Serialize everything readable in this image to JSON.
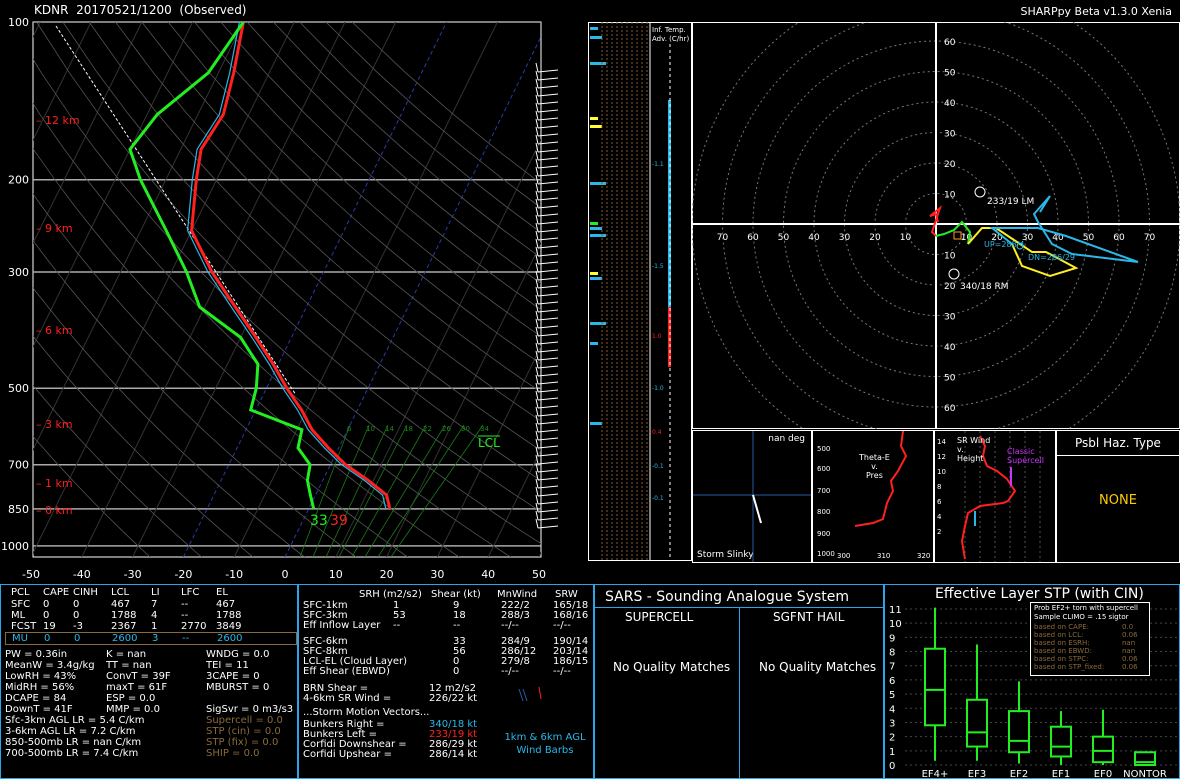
{
  "header": {
    "station": "KDNR",
    "datetime": "20170521/1200",
    "type": "(Observed)",
    "version": "SHARPpy Beta v1.3.0 Xenia"
  },
  "skewt": {
    "pressure_ticks": [
      "100",
      "200",
      "300",
      "500",
      "700",
      "850",
      "1000"
    ],
    "temp_ticks": [
      "-50",
      "-40",
      "-30",
      "-20",
      "-10",
      "0",
      "10",
      "20",
      "30",
      "40",
      "50"
    ],
    "height_labels": [
      "12 km",
      "9 km",
      "6 km",
      "3 km",
      "1 km",
      "0 km"
    ],
    "lcl_label": "LCL",
    "mixing_ratio_labels": [
      "6",
      "10",
      "14",
      "18",
      "22",
      "26",
      "30",
      "34"
    ],
    "surface_dewpoint": "33",
    "surface_temp": "39",
    "colors": {
      "temperature": "#ff2020",
      "dewpoint": "#22ee22",
      "virtual": "#2ab8e8",
      "dry_adiabat": "#555555"
    }
  },
  "chart_data": {
    "type": "line",
    "title": "",
    "xlabel": "",
    "ylabel": "",
    "pressure_levels_hPa": [
      850,
      800,
      750,
      700,
      650,
      600,
      550,
      500,
      450,
      400,
      350,
      300,
      250,
      200,
      175,
      150,
      125,
      100
    ],
    "series": [
      {
        "values": [
          16,
          14,
          9,
          3,
          -2,
          -7,
          -11,
          -16,
          -21,
          -27,
          -34,
          -42,
          -50,
          -54,
          -56,
          -55,
          -57,
          -60
        ]
      },
      {
        "values": [
          1,
          -1,
          -3,
          -4,
          -8,
          -9,
          -21,
          -22,
          -24,
          -30,
          -41,
          -47,
          -55,
          -65,
          -70,
          -68,
          -62,
          -60
        ]
      }
    ],
    "xlim": [
      -50,
      50
    ],
    "ylim": [
      1000,
      100
    ]
  },
  "inferred_temp_adv": {
    "title": "Inf. Temp. Adv. (C/hr)",
    "values": [
      "-1.1",
      "-1.5",
      "1.0",
      "-1.0",
      "0.4",
      "-0.1",
      "-0.1"
    ]
  },
  "hodograph": {
    "rings": [
      "10",
      "20",
      "30",
      "40",
      "50",
      "60"
    ],
    "axis_labels": [
      "70",
      "60",
      "50",
      "40",
      "30",
      "20",
      "10",
      "10",
      "20",
      "30",
      "40",
      "50",
      "60",
      "70"
    ],
    "lm_label": "233/19 LM",
    "rm_label": "340/18 RM",
    "up_label": "UP=288/4",
    "dn_label": "DN=286/29"
  },
  "storm_slinky": {
    "title": "nan deg",
    "footer": "Storm Slinky"
  },
  "theta_e": {
    "title": "Theta-E v. Pres",
    "ticks_y": [
      "500",
      "600",
      "700",
      "800",
      "900",
      "1000"
    ],
    "ticks_x": [
      "300",
      "310",
      "320"
    ]
  },
  "srwind": {
    "title": "SR Wind v. Height",
    "ticks": [
      "14",
      "12",
      "10",
      "8",
      "6",
      "4",
      "2"
    ],
    "supercell_label": "Classic Supercell"
  },
  "psbl_haz": {
    "title": "Psbl Haz. Type",
    "value": "NONE"
  },
  "parcel_table": {
    "headers": [
      "PCL",
      "CAPE",
      "CINH",
      "LCL",
      "LI",
      "LFC",
      "EL"
    ],
    "rows": [
      [
        "SFC",
        "0",
        "0",
        "467",
        "7",
        "--",
        "467"
      ],
      [
        "ML",
        "0",
        "0",
        "1788",
        "4",
        "--",
        "1788"
      ],
      [
        "FCST",
        "19",
        "-3",
        "2367",
        "1",
        "2770",
        "3849"
      ],
      [
        "MU",
        "0",
        "0",
        "2600",
        "3",
        "--",
        "2600"
      ]
    ]
  },
  "indices": {
    "left": [
      "PW = 0.36in",
      "MeanW = 3.4g/kg",
      "LowRH = 43%",
      "MidRH = 56%",
      "DCAPE = 84",
      "DownT = 41F"
    ],
    "mid": [
      "K = nan",
      "TT = nan",
      "ConvT = 39F",
      "maxT = 61F",
      "ESP = 0.0",
      "MMP = 0.0"
    ],
    "right": [
      "WNDG = 0.0",
      "TEI = 11",
      "3CAPE = 0",
      "MBURST = 0",
      "",
      "SigSvr = 0 m3/s3"
    ],
    "lapse": [
      "Sfc-3km AGL LR = 5.4 C/km",
      "3-6km AGL LR = 7.2 C/km",
      "850-500mb LR = nan C/km",
      "700-500mb LR = 7.4 C/km"
    ],
    "composites": [
      "Supercell = 0.0",
      "STP (cin) = 0.0",
      "STP (fix) = 0.0",
      "SHIP = 0.0"
    ]
  },
  "kinematics": {
    "headers": [
      "SRH (m2/s2)",
      "Shear (kt)",
      "MnWind",
      "SRW"
    ],
    "rows": [
      [
        "SFC-1km",
        "1",
        "9",
        "222/2",
        "165/18"
      ],
      [
        "SFC-3km",
        "53",
        "18",
        "288/3",
        "168/16"
      ],
      [
        "Eff Inflow Layer",
        "--",
        "--",
        "--/--",
        "--/--"
      ],
      [
        "SFC-6km",
        "",
        "33",
        "284/9",
        "190/14"
      ],
      [
        "SFC-8km",
        "",
        "56",
        "286/12",
        "203/14"
      ],
      [
        "LCL-EL (Cloud Layer)",
        "",
        "0",
        "279/8",
        "186/15"
      ],
      [
        "Eff Shear (EBWD)",
        "",
        "0",
        "--/--",
        "--/--"
      ]
    ],
    "brn_shear": "BRN Shear =",
    "brn_shear_val": "12 m2/s2",
    "sr_wind": "4-6km SR Wind =",
    "sr_wind_val": "226/22 kt",
    "storm_motion_title": "...Storm Motion Vectors...",
    "motion": [
      [
        "Bunkers Right =",
        "340/18 kt"
      ],
      [
        "Bunkers Left =",
        "233/19 kt"
      ],
      [
        "Corfidi Downshear =",
        "286/29 kt"
      ],
      [
        "Corfidi Upshear =",
        "286/14 kt"
      ]
    ],
    "barbs_label": "1km & 6km AGL Wind Barbs"
  },
  "sars": {
    "title": "SARS - Sounding Analogue System",
    "supercell": "SUPERCELL",
    "hail": "SGFNT HAIL",
    "supercell_result": "No Quality Matches",
    "hail_result": "No Quality Matches"
  },
  "stp": {
    "title": "Effective Layer STP (with CIN)",
    "y_ticks": [
      "11",
      "10",
      "9",
      "8",
      "7",
      "6",
      "5",
      "4",
      "3",
      "2",
      "1",
      "0"
    ],
    "categories": [
      "EF4+",
      "EF3",
      "EF2",
      "EF1",
      "EF0",
      "NONTOR"
    ],
    "legend_title": "Prob EF2+ torn with supercell",
    "legend_sub": "Sample CLIMO = .15 sigtor",
    "legend_rows": [
      [
        "based on CAPE:",
        "0.0"
      ],
      [
        "based on LCL:",
        "0.06"
      ],
      [
        "based on ESRH:",
        "nan"
      ],
      [
        "based on EBWD:",
        "nan"
      ],
      [
        "based on STPC:",
        "0.06"
      ],
      [
        "based on STP_fixed:",
        "0.06"
      ]
    ]
  }
}
